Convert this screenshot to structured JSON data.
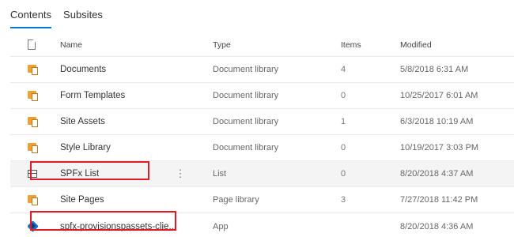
{
  "tabs": [
    {
      "label": "Contents",
      "active": true
    },
    {
      "label": "Subsites",
      "active": false
    }
  ],
  "columns": {
    "name": "Name",
    "type": "Type",
    "items": "Items",
    "modified": "Modified"
  },
  "rows": [
    {
      "icon": "document-library-icon",
      "name": "Documents",
      "type": "Document library",
      "items": "4",
      "modified": "5/8/2018 6:31 AM"
    },
    {
      "icon": "document-library-icon",
      "name": "Form Templates",
      "type": "Document library",
      "items": "0",
      "modified": "10/25/2017 6:01 AM"
    },
    {
      "icon": "document-library-icon",
      "name": "Site Assets",
      "type": "Document library",
      "items": "1",
      "modified": "6/3/2018 10:19 AM"
    },
    {
      "icon": "document-library-icon",
      "name": "Style Library",
      "type": "Document library",
      "items": "0",
      "modified": "10/19/2017 3:03 PM"
    },
    {
      "icon": "list-icon",
      "name": "SPFx List",
      "type": "List",
      "items": "0",
      "modified": "8/20/2018 4:37 AM",
      "more": "⋮",
      "highlighted": true
    },
    {
      "icon": "document-library-icon",
      "name": "Site Pages",
      "type": "Page library",
      "items": "3",
      "modified": "7/27/2018 11:42 PM"
    },
    {
      "icon": "app-icon",
      "name": "spfx-provisionspassets-clie...",
      "type": "App",
      "items": "",
      "modified": "8/20/2018 4:36 AM",
      "highlighted": true
    }
  ],
  "colors": {
    "accent": "#0078d4",
    "highlight_box": "#e01b24",
    "library_icon": "#f0a030",
    "app_icon": "#1b6ec2"
  }
}
